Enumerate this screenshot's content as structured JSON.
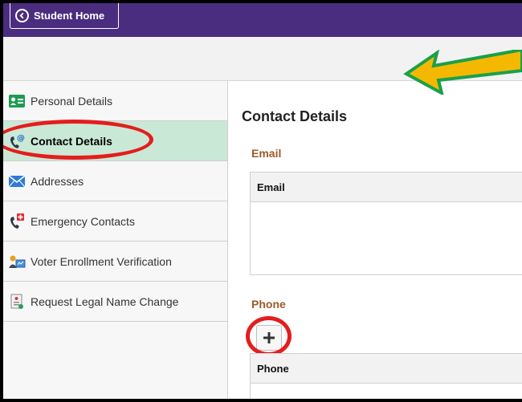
{
  "topbar": {
    "home_label": "Student Home",
    "color": "#4b2d7f"
  },
  "sidebar": {
    "items": [
      {
        "label": "Personal Details",
        "icon": "id-card-icon"
      },
      {
        "label": "Contact Details",
        "icon": "phone-at-icon",
        "active": true
      },
      {
        "label": "Addresses",
        "icon": "envelope-icon"
      },
      {
        "label": "Emergency Contacts",
        "icon": "phone-cross-icon"
      },
      {
        "label": "Voter Enrollment Verification",
        "icon": "voter-icon"
      },
      {
        "label": "Request Legal Name Change",
        "icon": "document-icon"
      }
    ]
  },
  "main": {
    "title": "Contact Details",
    "email": {
      "section_label": "Email",
      "column_header": "Email"
    },
    "phone": {
      "section_label": "Phone",
      "column_header": "Phone",
      "add_icon": "plus-icon"
    }
  },
  "annotations": {
    "circle_color": "#e41d1d",
    "arrow_fill": "#f5b800",
    "arrow_stroke": "#1aa04a"
  }
}
